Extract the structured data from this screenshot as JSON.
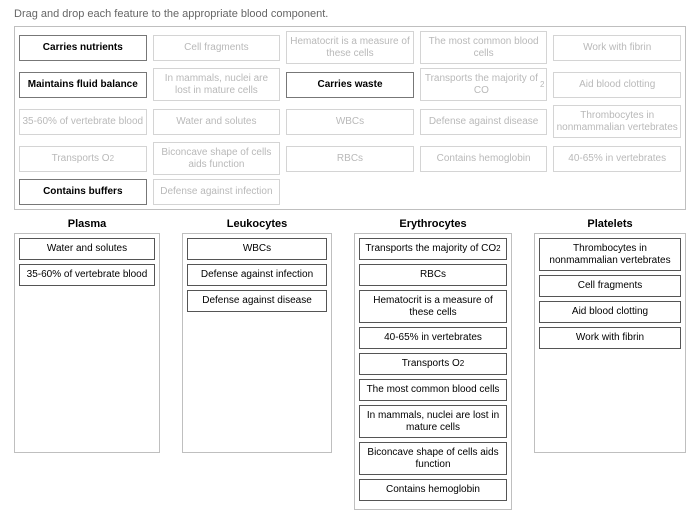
{
  "instructions": "Drag and drop each feature to the appropriate blood component.",
  "pool": [
    {
      "label": "Carries nutrients",
      "state": "avail"
    },
    {
      "label": "Cell fragments",
      "state": "used"
    },
    {
      "label": "Hematocrit is a measure of these cells",
      "state": "used"
    },
    {
      "label": "The most common blood cells",
      "state": "used"
    },
    {
      "label": "Work with fibrin",
      "state": "used"
    },
    {
      "label": "Maintains fluid balance",
      "state": "avail"
    },
    {
      "label": "In mammals, nuclei are lost in mature cells",
      "state": "used"
    },
    {
      "label": "Carries waste",
      "state": "avail"
    },
    {
      "label": "Transports the majority of CO₂",
      "state": "used"
    },
    {
      "label": "Aid blood clotting",
      "state": "used"
    },
    {
      "label": "35-60% of vertebrate blood",
      "state": "used"
    },
    {
      "label": "Water and solutes",
      "state": "used"
    },
    {
      "label": "WBCs",
      "state": "used"
    },
    {
      "label": "Defense against disease",
      "state": "used"
    },
    {
      "label": "Thrombocytes in nonmammalian vertebrates",
      "state": "used"
    },
    {
      "label": "Transports O₂",
      "state": "used"
    },
    {
      "label": "Biconcave shape of cells aids function",
      "state": "used"
    },
    {
      "label": "RBCs",
      "state": "used"
    },
    {
      "label": "Contains hemoglobin",
      "state": "used"
    },
    {
      "label": "40-65% in vertebrates",
      "state": "used"
    },
    {
      "label": "Contains buffers",
      "state": "avail"
    },
    {
      "label": "Defense against infection",
      "state": "used"
    }
  ],
  "categories": [
    {
      "title": "Plasma",
      "widthClass": "w-plasma",
      "items": [
        "Water and solutes",
        "35-60% of vertebrate blood"
      ]
    },
    {
      "title": "Leukocytes",
      "widthClass": "w-leukocytes",
      "items": [
        "WBCs",
        "Defense against infection",
        "Defense against disease"
      ]
    },
    {
      "title": "Erythrocytes",
      "widthClass": "w-erythro",
      "items": [
        "Transports the majority of CO₂",
        "RBCs",
        "Hematocrit is a measure of these cells",
        "40-65% in vertebrates",
        "Transports O₂",
        "The most common blood cells",
        "In mammals, nuclei are lost in mature cells",
        "Biconcave shape of cells aids function",
        "Contains hemoglobin"
      ]
    },
    {
      "title": "Platelets",
      "widthClass": "w-platelets",
      "items": [
        "Thrombocytes in nonmammalian vertebrates",
        "Cell fragments",
        "Aid blood clotting",
        "Work with fibrin"
      ]
    }
  ]
}
